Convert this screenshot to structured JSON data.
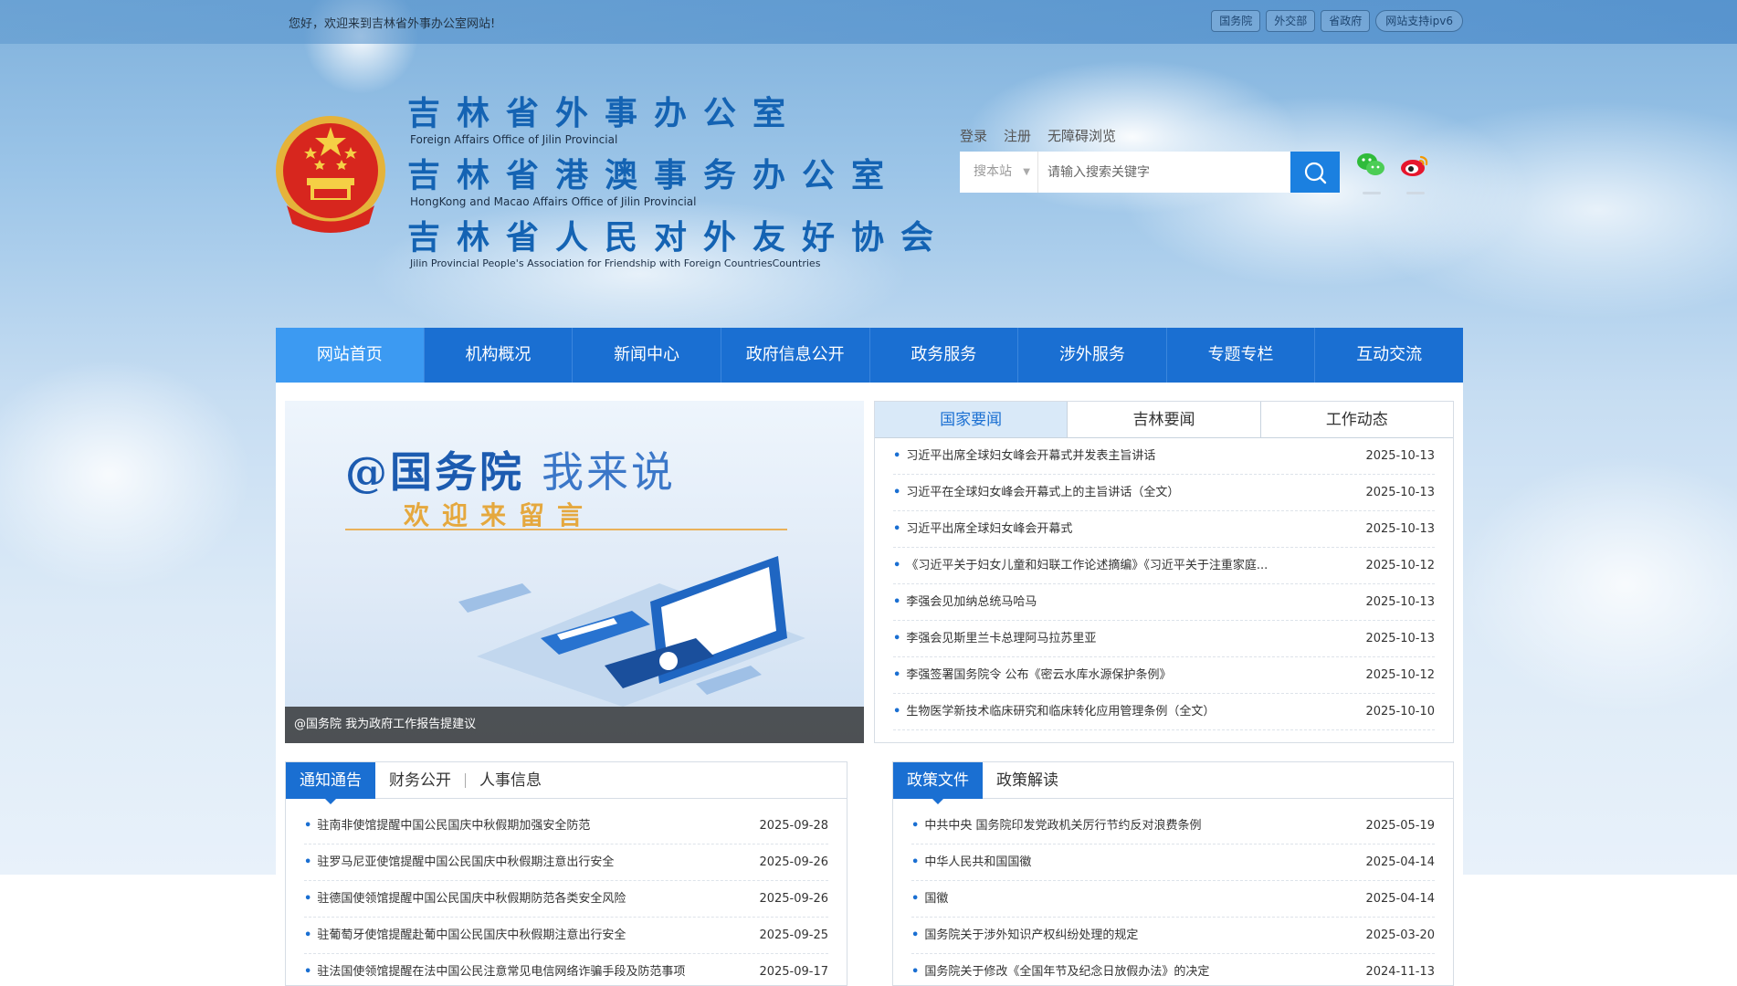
{
  "topbar": {
    "welcome": "您好，欢迎来到吉林省外事办公室网站!",
    "links": [
      "国务院",
      "外交部",
      "省政府",
      "网站支持ipv6"
    ]
  },
  "header": {
    "titles": [
      {
        "cn": "吉林省外事办公室",
        "en": "Foreign Affairs Office of Jilin Provincial"
      },
      {
        "cn": "吉林省港澳事务办公室",
        "en": "HongKong and Macao Affairs Office of Jilin Provincial"
      },
      {
        "cn": "吉林省人民对外友好协会",
        "en": "Jilin Provincial People's Association for Friendship with Foreign CountriesCountries"
      }
    ],
    "user_links": [
      "登录",
      "注册",
      "无障碍浏览"
    ],
    "search": {
      "scope": "搜本站",
      "placeholder": "请输入搜索关键字"
    }
  },
  "nav": [
    "网站首页",
    "机构概况",
    "新闻中心",
    "政府信息公开",
    "政务服务",
    "涉外服务",
    "专题专栏",
    "互动交流"
  ],
  "banner": {
    "title_main": "@国务院",
    "title_light": "我来说",
    "subtitle": "欢迎来留言",
    "caption": "@国务院 我为政府工作报告提建议"
  },
  "news_tabs": [
    "国家要闻",
    "吉林要闻",
    "工作动态"
  ],
  "news": [
    {
      "title": "习近平出席全球妇女峰会开幕式并发表主旨讲话",
      "date": "2025-10-13"
    },
    {
      "title": "习近平在全球妇女峰会开幕式上的主旨讲话（全文）",
      "date": "2025-10-13"
    },
    {
      "title": "习近平出席全球妇女峰会开幕式",
      "date": "2025-10-13"
    },
    {
      "title": "《习近平关于妇女儿童和妇联工作论述摘编》《习近平关于注重家庭...",
      "date": "2025-10-12"
    },
    {
      "title": "李强会见加纳总统马哈马",
      "date": "2025-10-13"
    },
    {
      "title": "李强会见斯里兰卡总理阿马拉苏里亚",
      "date": "2025-10-13"
    },
    {
      "title": "李强签署国务院令 公布《密云水库水源保护条例》",
      "date": "2025-10-12"
    },
    {
      "title": "生物医学新技术临床研究和临床转化应用管理条例（全文）",
      "date": "2025-10-10"
    }
  ],
  "notice_tabs": [
    "通知通告",
    "财务公开",
    "人事信息"
  ],
  "notices": [
    {
      "title": "驻南非使馆提醒中国公民国庆中秋假期加强安全防范",
      "date": "2025-09-28"
    },
    {
      "title": "驻罗马尼亚使馆提醒中国公民国庆中秋假期注意出行安全",
      "date": "2025-09-26"
    },
    {
      "title": "驻德国使领馆提醒中国公民国庆中秋假期防范各类安全风险",
      "date": "2025-09-26"
    },
    {
      "title": "驻葡萄牙使馆提醒赴葡中国公民国庆中秋假期注意出行安全",
      "date": "2025-09-25"
    },
    {
      "title": "驻法国使领馆提醒在法中国公民注意常见电信网络诈骗手段及防范事项",
      "date": "2025-09-17"
    }
  ],
  "policy_tabs": [
    "政策文件",
    "政策解读"
  ],
  "policies": [
    {
      "title": "中共中央 国务院印发党政机关厉行节约反对浪费条例",
      "date": "2025-05-19"
    },
    {
      "title": "中华人民共和国国徽",
      "date": "2025-04-14"
    },
    {
      "title": "国徽",
      "date": "2025-04-14"
    },
    {
      "title": "国务院关于涉外知识产权纠纷处理的规定",
      "date": "2025-03-20"
    },
    {
      "title": "国务院关于修改《全国年节及纪念日放假办法》的决定",
      "date": "2024-11-13"
    }
  ],
  "colors": {
    "nav": "#1a6fd2",
    "nav_active": "#3c9af2",
    "title": "#1463b3",
    "accent": "#1b80e0"
  },
  "icons": {
    "search": "search-icon",
    "wechat": "wechat-icon",
    "weibo": "weibo-icon",
    "emblem": "national-emblem-icon"
  }
}
